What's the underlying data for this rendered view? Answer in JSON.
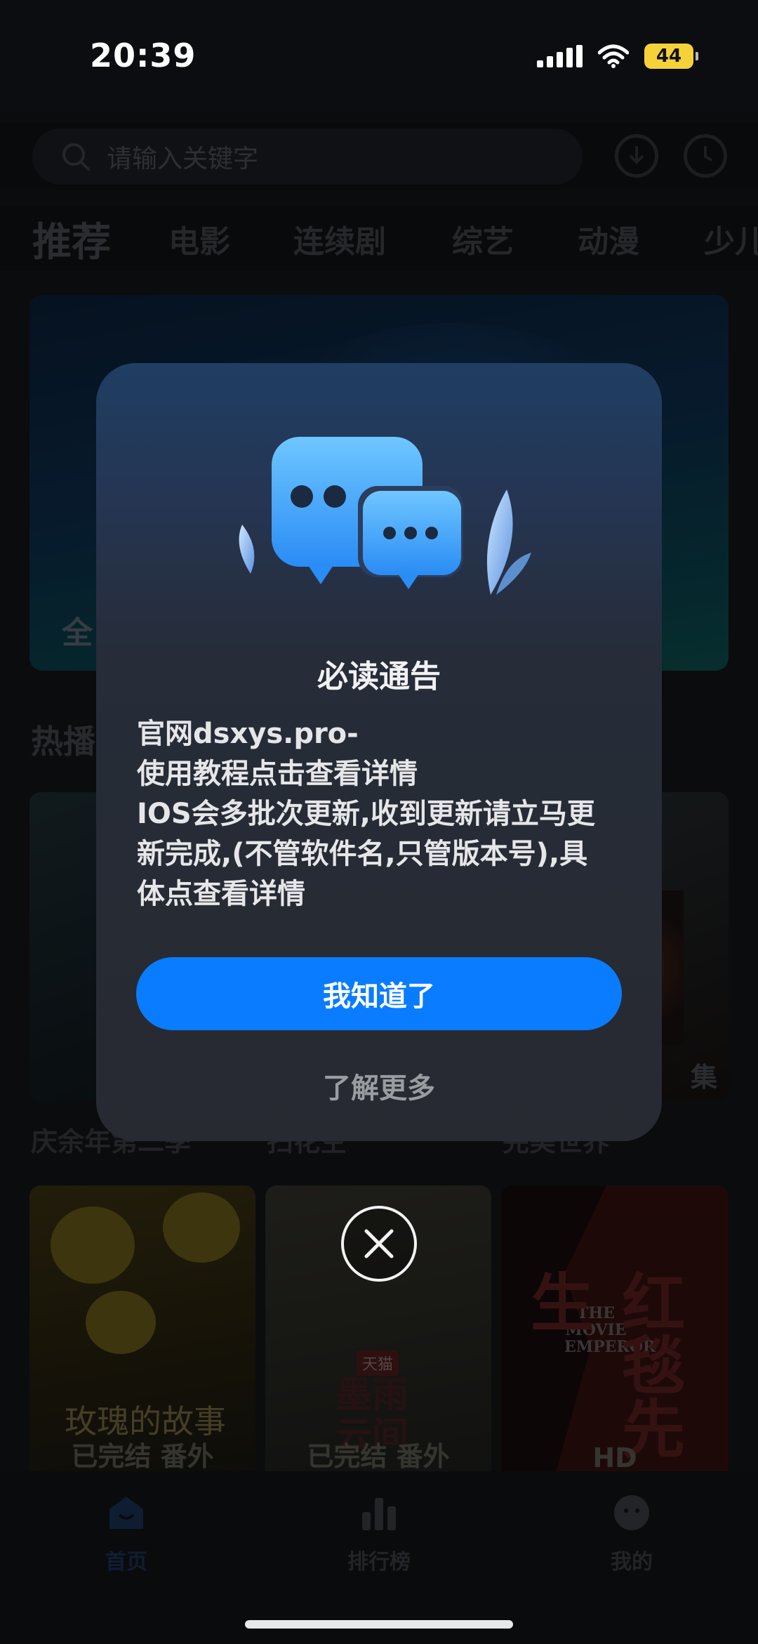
{
  "status_bar": {
    "time": "20:39",
    "battery": "44"
  },
  "search": {
    "placeholder": "请输入关键字"
  },
  "tabs": [
    "推荐",
    "电影",
    "连续剧",
    "综艺",
    "动漫",
    "少儿"
  ],
  "banner": {
    "text": "全"
  },
  "sections": {
    "hot": "热播"
  },
  "posters_row1": {
    "titles": [
      "庆余年第二季",
      "扫花空",
      "完美世界"
    ],
    "badge": "集"
  },
  "posters_row2": {
    "p4": {
      "title_art": "玫瑰的故事",
      "caption": "已完结 番外"
    },
    "p5": {
      "tag": "天猫",
      "title_art": "墨雨云间",
      "caption": "已完结 番外"
    },
    "p6": {
      "title_art": "红毯先生",
      "en_title": "THE MOVIE EMPEROR",
      "caption": "HD"
    }
  },
  "bottom_nav": [
    {
      "label": "首页",
      "icon": "home-icon"
    },
    {
      "label": "排行榜",
      "icon": "ranking-icon"
    },
    {
      "label": "我的",
      "icon": "profile-icon"
    }
  ],
  "modal": {
    "title": "必读通告",
    "lines": [
      "官网dsxys.pro-",
      "使用教程点击查看详情",
      "IOS会多批次更新,收到更新请立马更",
      "新完成,(不管软件名,只管版本号),具",
      "体点查看详情"
    ],
    "confirm_label": "我知道了",
    "more_label": "了解更多"
  },
  "colors": {
    "accent": "#0a7cff",
    "battery": "#f5d23a"
  }
}
